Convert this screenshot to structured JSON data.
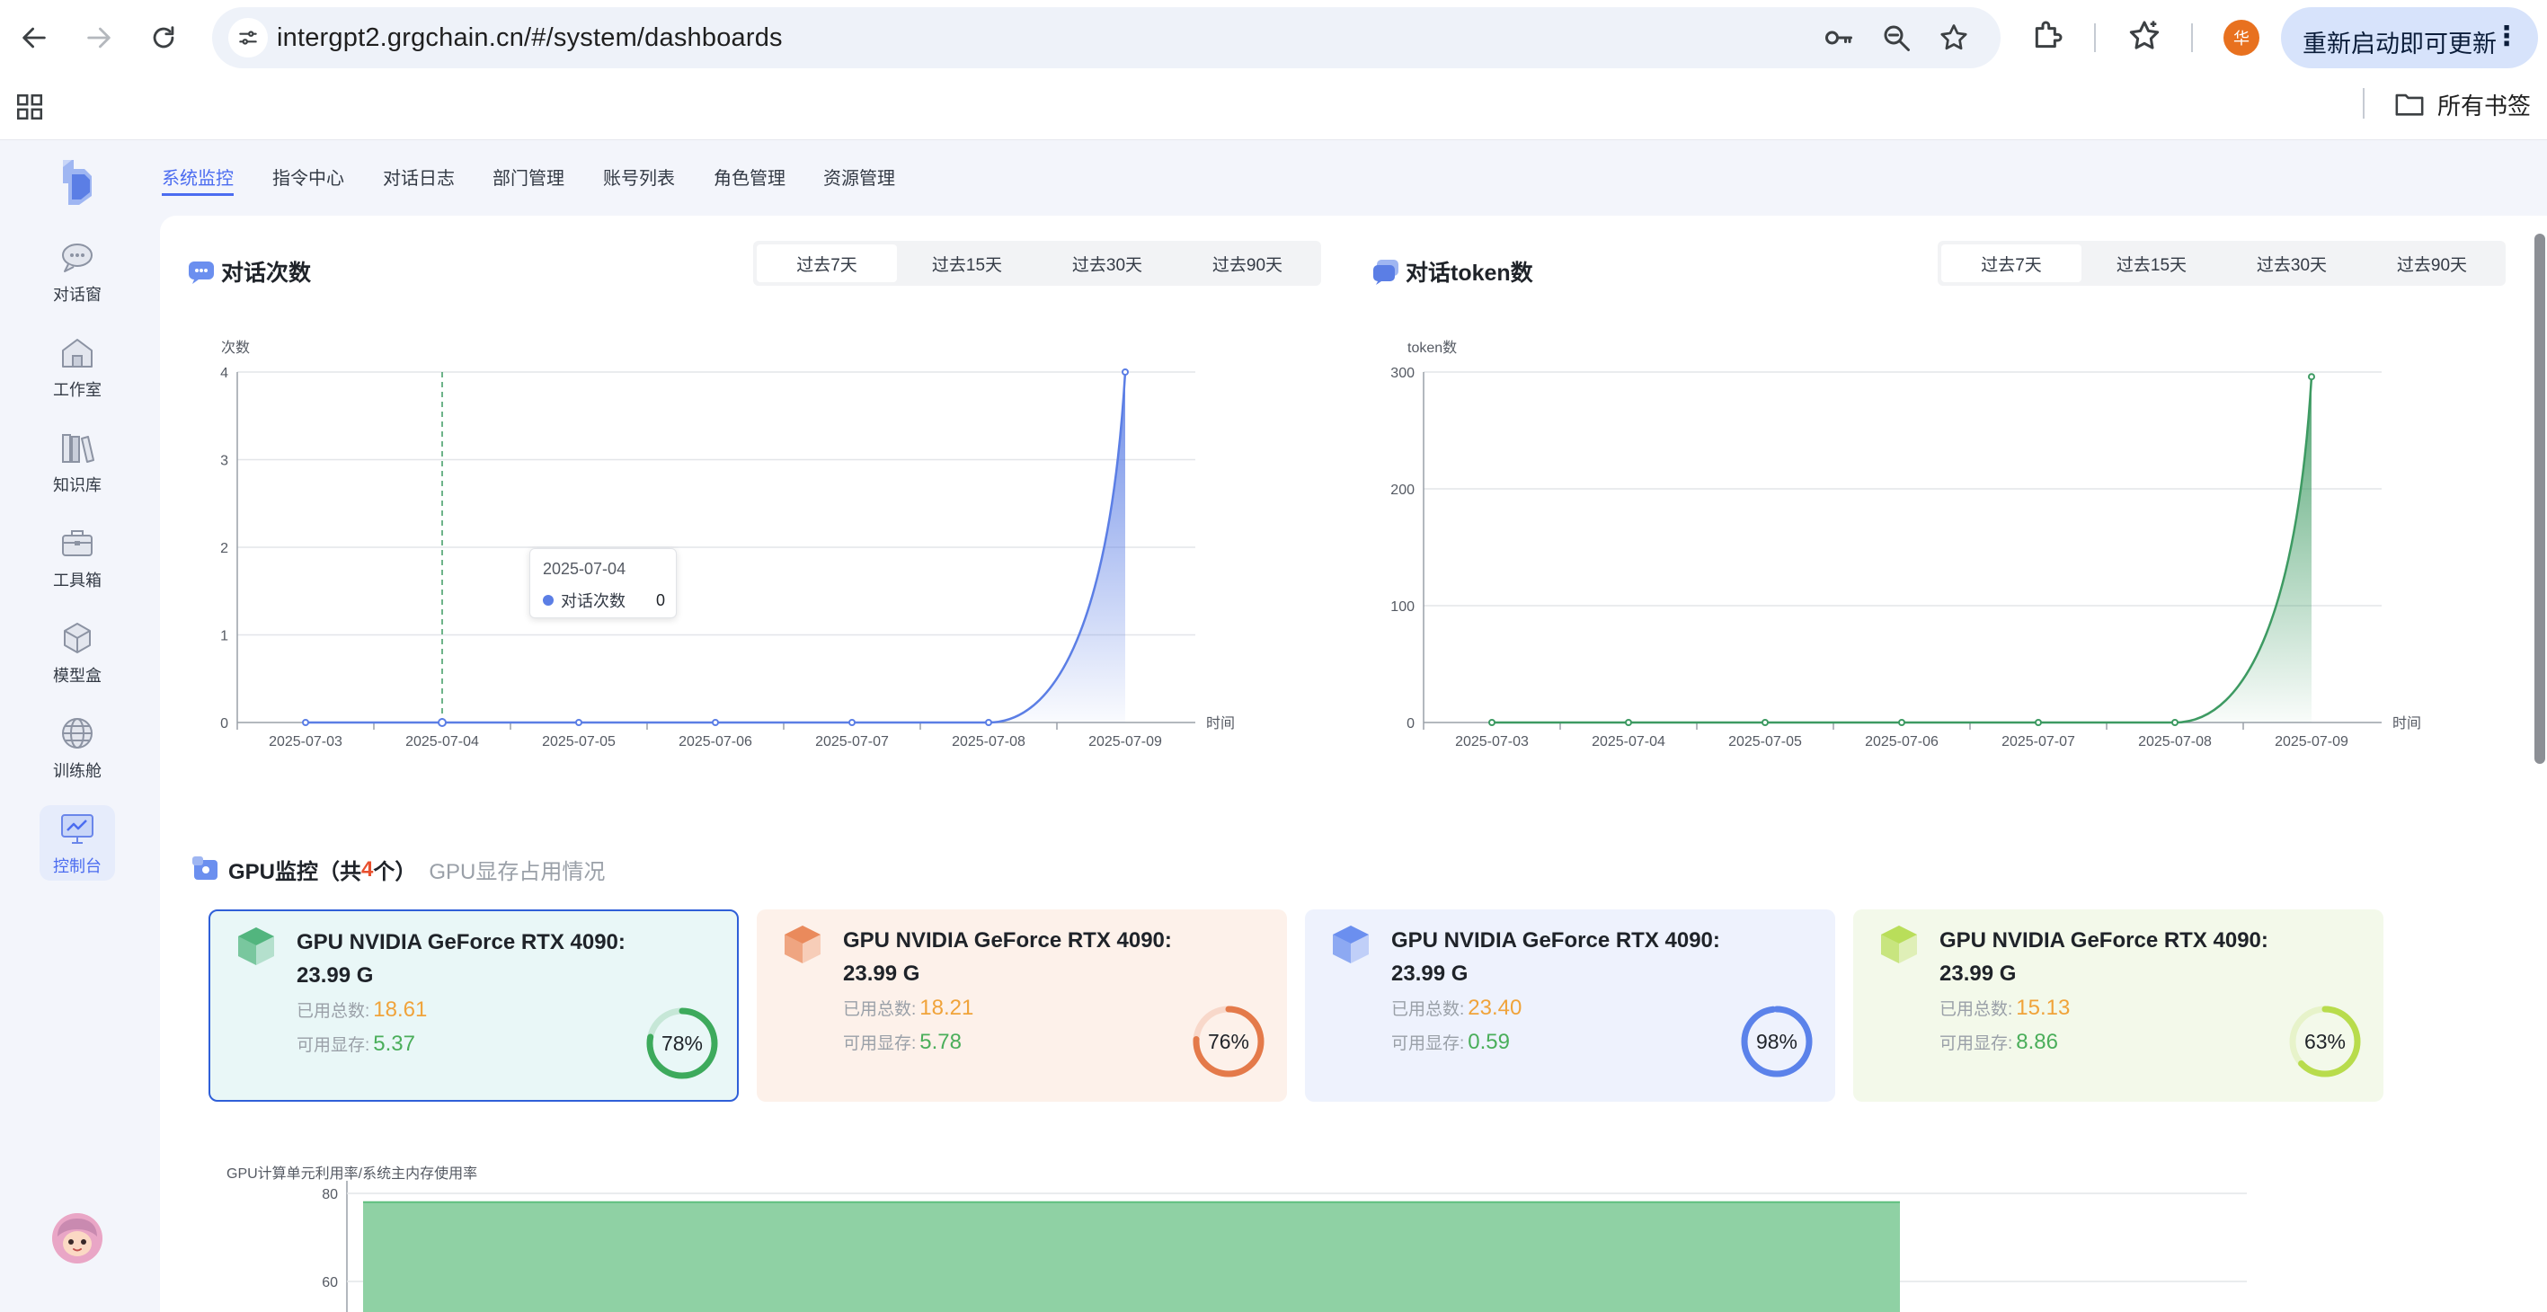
{
  "browser": {
    "url": "intergpt2.grgchain.cn/#/system/dashboards",
    "profile_initial": "华",
    "update_label": "重新启动即可更新",
    "all_bookmarks_label": "所有书签"
  },
  "sidebar": {
    "items": [
      {
        "label": "对话窗",
        "icon": "chat-bubble-icon"
      },
      {
        "label": "工作室",
        "icon": "studio-house-icon"
      },
      {
        "label": "知识库",
        "icon": "books-icon"
      },
      {
        "label": "工具箱",
        "icon": "toolbox-icon"
      },
      {
        "label": "模型盒",
        "icon": "model-box-icon"
      },
      {
        "label": "训练舱",
        "icon": "globe-icon"
      },
      {
        "label": "控制台",
        "icon": "monitor-chart-icon",
        "active": true
      }
    ]
  },
  "topnav": {
    "tabs": [
      "系统监控",
      "指令中心",
      "对话日志",
      "部门管理",
      "账号列表",
      "角色管理",
      "资源管理"
    ],
    "active_tab": "系统监控"
  },
  "range_options": [
    "过去7天",
    "过去15天",
    "过去30天",
    "过去90天"
  ],
  "conversation_panel": {
    "title": "对话次数",
    "selected_range": "过去7天"
  },
  "token_panel": {
    "title": "对话token数",
    "selected_range": "过去7天"
  },
  "tooltip": {
    "date": "2025-07-04",
    "series": "对话次数",
    "value": "0"
  },
  "chart_data": [
    {
      "type": "area",
      "x": [
        "2025-07-03",
        "2025-07-04",
        "2025-07-05",
        "2025-07-06",
        "2025-07-07",
        "2025-07-08",
        "2025-07-09"
      ],
      "series": [
        {
          "name": "对话次数",
          "values": [
            0,
            0,
            0,
            0,
            0,
            0,
            4
          ]
        }
      ],
      "ylabel": "次数",
      "xlabel": "时间",
      "ylim": [
        0,
        4
      ],
      "yticks": [
        0,
        1,
        2,
        3,
        4
      ],
      "grid": true,
      "color": "#5b7ee5"
    },
    {
      "type": "area",
      "x": [
        "2025-07-03",
        "2025-07-04",
        "2025-07-05",
        "2025-07-06",
        "2025-07-07",
        "2025-07-08",
        "2025-07-09"
      ],
      "series": [
        {
          "values": [
            0,
            0,
            0,
            0,
            0,
            0,
            296
          ]
        }
      ],
      "ylabel": "token数",
      "xlabel": "时间",
      "ylim": [
        0,
        300
      ],
      "yticks": [
        0,
        100,
        200,
        300
      ],
      "grid": true,
      "color": "#3d9a62"
    },
    {
      "type": "bar",
      "title": "GPU计算单元利用率/系统主内存使用率",
      "values": [
        78
      ],
      "yticks_visible": [
        60,
        80
      ],
      "color": "#8fd1a4"
    }
  ],
  "gpu": {
    "title_prefix": "GPU监控（共",
    "count": "4",
    "title_suffix": "个）",
    "subtitle": "GPU显存占用情况",
    "used_label": "已用总数:",
    "free_label": "可用显存:",
    "cards": [
      {
        "name": "GPU NVIDIA GeForce RTX 4090: 23.99 G",
        "used": "18.61",
        "free": "5.37",
        "percent": 78,
        "percent_label": "78%",
        "bg": "#e9f7f7",
        "ring": "#3daa5c",
        "cube": "#52b57e",
        "selected": true
      },
      {
        "name": "GPU NVIDIA GeForce RTX 4090: 23.99 G",
        "used": "18.21",
        "free": "5.78",
        "percent": 76,
        "percent_label": "76%",
        "bg": "#fdf1ea",
        "ring": "#e47a4a",
        "cube": "#ea8a5c",
        "selected": false
      },
      {
        "name": "GPU NVIDIA GeForce RTX 4090: 23.99 G",
        "used": "23.40",
        "free": "0.59",
        "percent": 98,
        "percent_label": "98%",
        "bg": "#eef2fd",
        "ring": "#5b82ea",
        "cube": "#6b8fef",
        "selected": false
      },
      {
        "name": "GPU NVIDIA GeForce RTX 4090: 23.99 G",
        "used": "15.13",
        "free": "8.86",
        "percent": 63,
        "percent_label": "63%",
        "bg": "#f3f9ea",
        "ring": "#b8dc4c",
        "cube": "#b9de5a",
        "selected": false
      }
    ]
  }
}
